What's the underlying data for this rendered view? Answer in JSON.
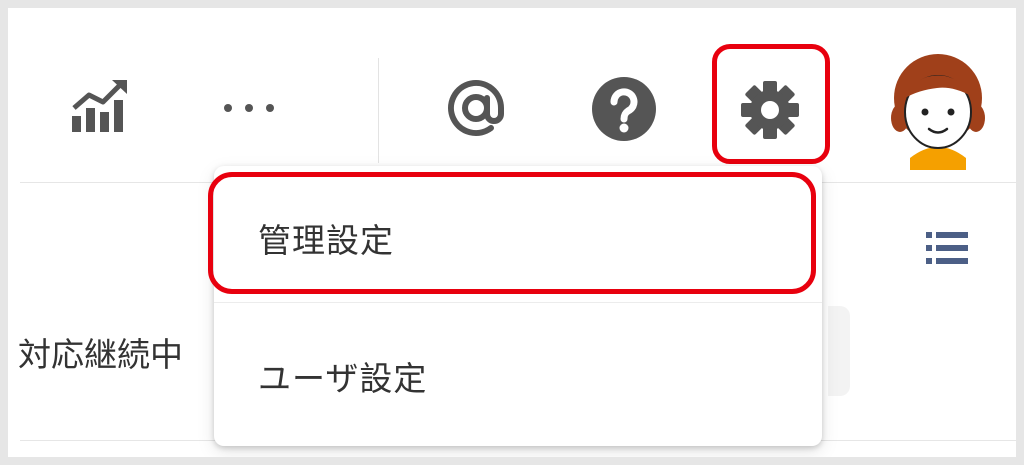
{
  "header": {
    "icons": [
      {
        "name": "analytics-chart-icon"
      },
      {
        "name": "more-icon"
      },
      {
        "name": "mention-icon"
      },
      {
        "name": "help-icon"
      },
      {
        "name": "settings-gear-icon"
      },
      {
        "name": "user-avatar"
      }
    ]
  },
  "menu": {
    "items": [
      {
        "label": "管理設定"
      },
      {
        "label": "ユーザ設定"
      }
    ]
  },
  "content": {
    "status_text": "対応継続中"
  },
  "colors": {
    "highlight": "#e8000e",
    "icon_gray": "#555555",
    "list_icon": "#4c5f86",
    "avatar_hair": "#a0401a",
    "avatar_shirt": "#f5a000"
  }
}
